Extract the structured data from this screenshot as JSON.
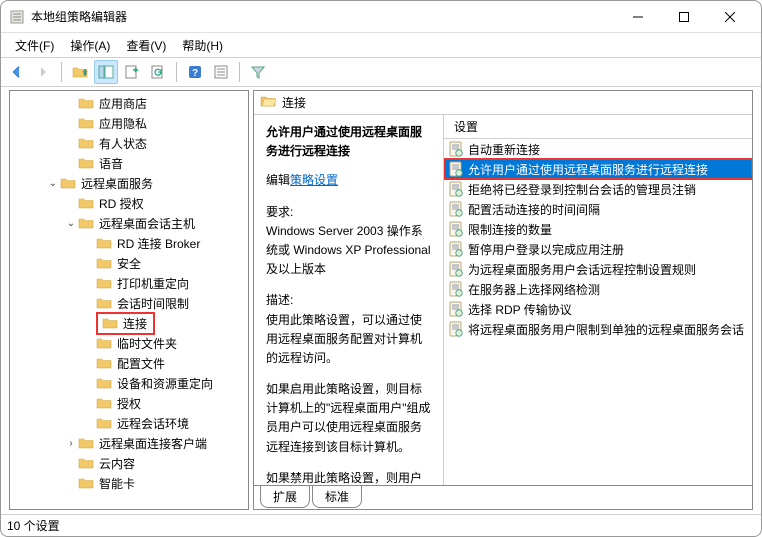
{
  "window": {
    "title": "本地组策略编辑器"
  },
  "menubar": {
    "file": "文件(F)",
    "action": "操作(A)",
    "view": "查看(V)",
    "help": "帮助(H)"
  },
  "tree": {
    "items": [
      {
        "label": "应用商店",
        "indent": 3,
        "toggle": ""
      },
      {
        "label": "应用隐私",
        "indent": 3,
        "toggle": ""
      },
      {
        "label": "有人状态",
        "indent": 3,
        "toggle": ""
      },
      {
        "label": "语音",
        "indent": 3,
        "toggle": ""
      },
      {
        "label": "远程桌面服务",
        "indent": 2,
        "toggle": "v"
      },
      {
        "label": "RD 授权",
        "indent": 3,
        "toggle": ""
      },
      {
        "label": "远程桌面会话主机",
        "indent": 3,
        "toggle": "v"
      },
      {
        "label": "RD 连接 Broker",
        "indent": 4,
        "toggle": ""
      },
      {
        "label": "安全",
        "indent": 4,
        "toggle": ""
      },
      {
        "label": "打印机重定向",
        "indent": 4,
        "toggle": ""
      },
      {
        "label": "会话时间限制",
        "indent": 4,
        "toggle": ""
      },
      {
        "label": "连接",
        "indent": 4,
        "toggle": "",
        "highlighted": true
      },
      {
        "label": "临时文件夹",
        "indent": 4,
        "toggle": ""
      },
      {
        "label": "配置文件",
        "indent": 4,
        "toggle": ""
      },
      {
        "label": "设备和资源重定向",
        "indent": 4,
        "toggle": ""
      },
      {
        "label": "授权",
        "indent": 4,
        "toggle": ""
      },
      {
        "label": "远程会话环境",
        "indent": 4,
        "toggle": ""
      },
      {
        "label": "远程桌面连接客户端",
        "indent": 3,
        "toggle": ">"
      },
      {
        "label": "云内容",
        "indent": 3,
        "toggle": ""
      },
      {
        "label": "智能卡",
        "indent": 3,
        "toggle": ""
      }
    ]
  },
  "content": {
    "header_label": "连接",
    "desc": {
      "title": "允许用户通过使用远程桌面服务进行远程连接",
      "edit_prefix": "编辑",
      "edit_link": "策略设置",
      "req_label": "要求:",
      "req_body": "Windows Server 2003 操作系统或 Windows XP Professional 及以上版本",
      "desc_label": "描述:",
      "desc_body1": "使用此策略设置，可以通过使用远程桌面服务配置对计算机的远程访问。",
      "desc_body2": "如果启用此策略设置，则目标计算机上的\"远程桌面用户\"组成员用户可以使用远程桌面服务远程连接到该目标计算机。",
      "desc_body3": "如果禁用此策略设置，则用户无法"
    },
    "list_header": "设置",
    "list": [
      {
        "label": "自动重新连接"
      },
      {
        "label": "允许用户通过使用远程桌面服务进行远程连接",
        "selected": true,
        "highlighted": true
      },
      {
        "label": "拒绝将已经登录到控制台会话的管理员注销"
      },
      {
        "label": "配置活动连接的时间间隔"
      },
      {
        "label": "限制连接的数量"
      },
      {
        "label": "暂停用户登录以完成应用注册"
      },
      {
        "label": "为远程桌面服务用户会话远程控制设置规则"
      },
      {
        "label": "在服务器上选择网络检测"
      },
      {
        "label": "选择 RDP 传输协议"
      },
      {
        "label": "将远程桌面服务用户限制到单独的远程桌面服务会话"
      }
    ],
    "tabs": {
      "extended": "扩展",
      "standard": "标准"
    }
  },
  "statusbar": {
    "text": "10 个设置"
  }
}
